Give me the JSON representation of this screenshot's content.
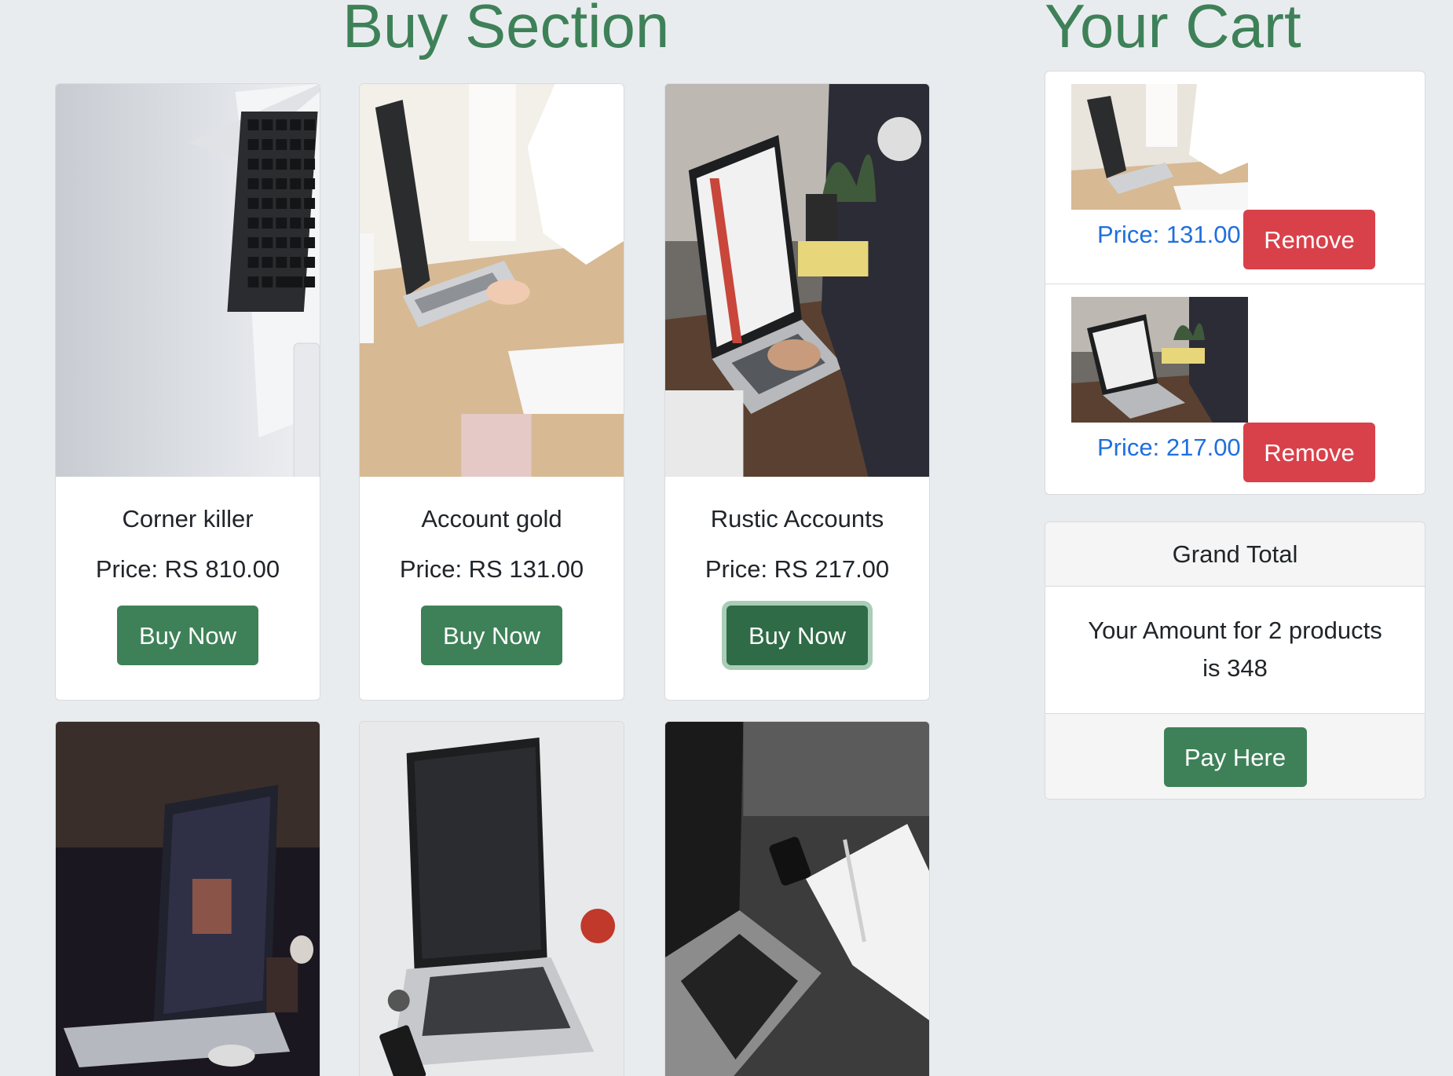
{
  "buy_section": {
    "heading": "Buy Section",
    "products": [
      {
        "title": "Corner killer",
        "price": "Price: RS 810.00",
        "button": "Buy Now"
      },
      {
        "title": "Account gold",
        "price": "Price: RS 131.00",
        "button": "Buy Now"
      },
      {
        "title": "Rustic Accounts",
        "price": "Price: RS 217.00",
        "button": "Buy Now"
      }
    ]
  },
  "cart": {
    "heading": "Your Cart",
    "items": [
      {
        "price": "Price: 131.00",
        "remove_label": "Remove"
      },
      {
        "price": "Price: 217.00",
        "remove_label": "Remove"
      }
    ],
    "grand_total": {
      "header": "Grand Total",
      "line1": "Your Amount for 2 products",
      "line2": "is 348",
      "pay_label": "Pay Here"
    }
  },
  "colors": {
    "accent_green": "#3e8158",
    "danger_red": "#d9414a",
    "price_blue": "#1f6fde",
    "background": "#e9ecef"
  }
}
